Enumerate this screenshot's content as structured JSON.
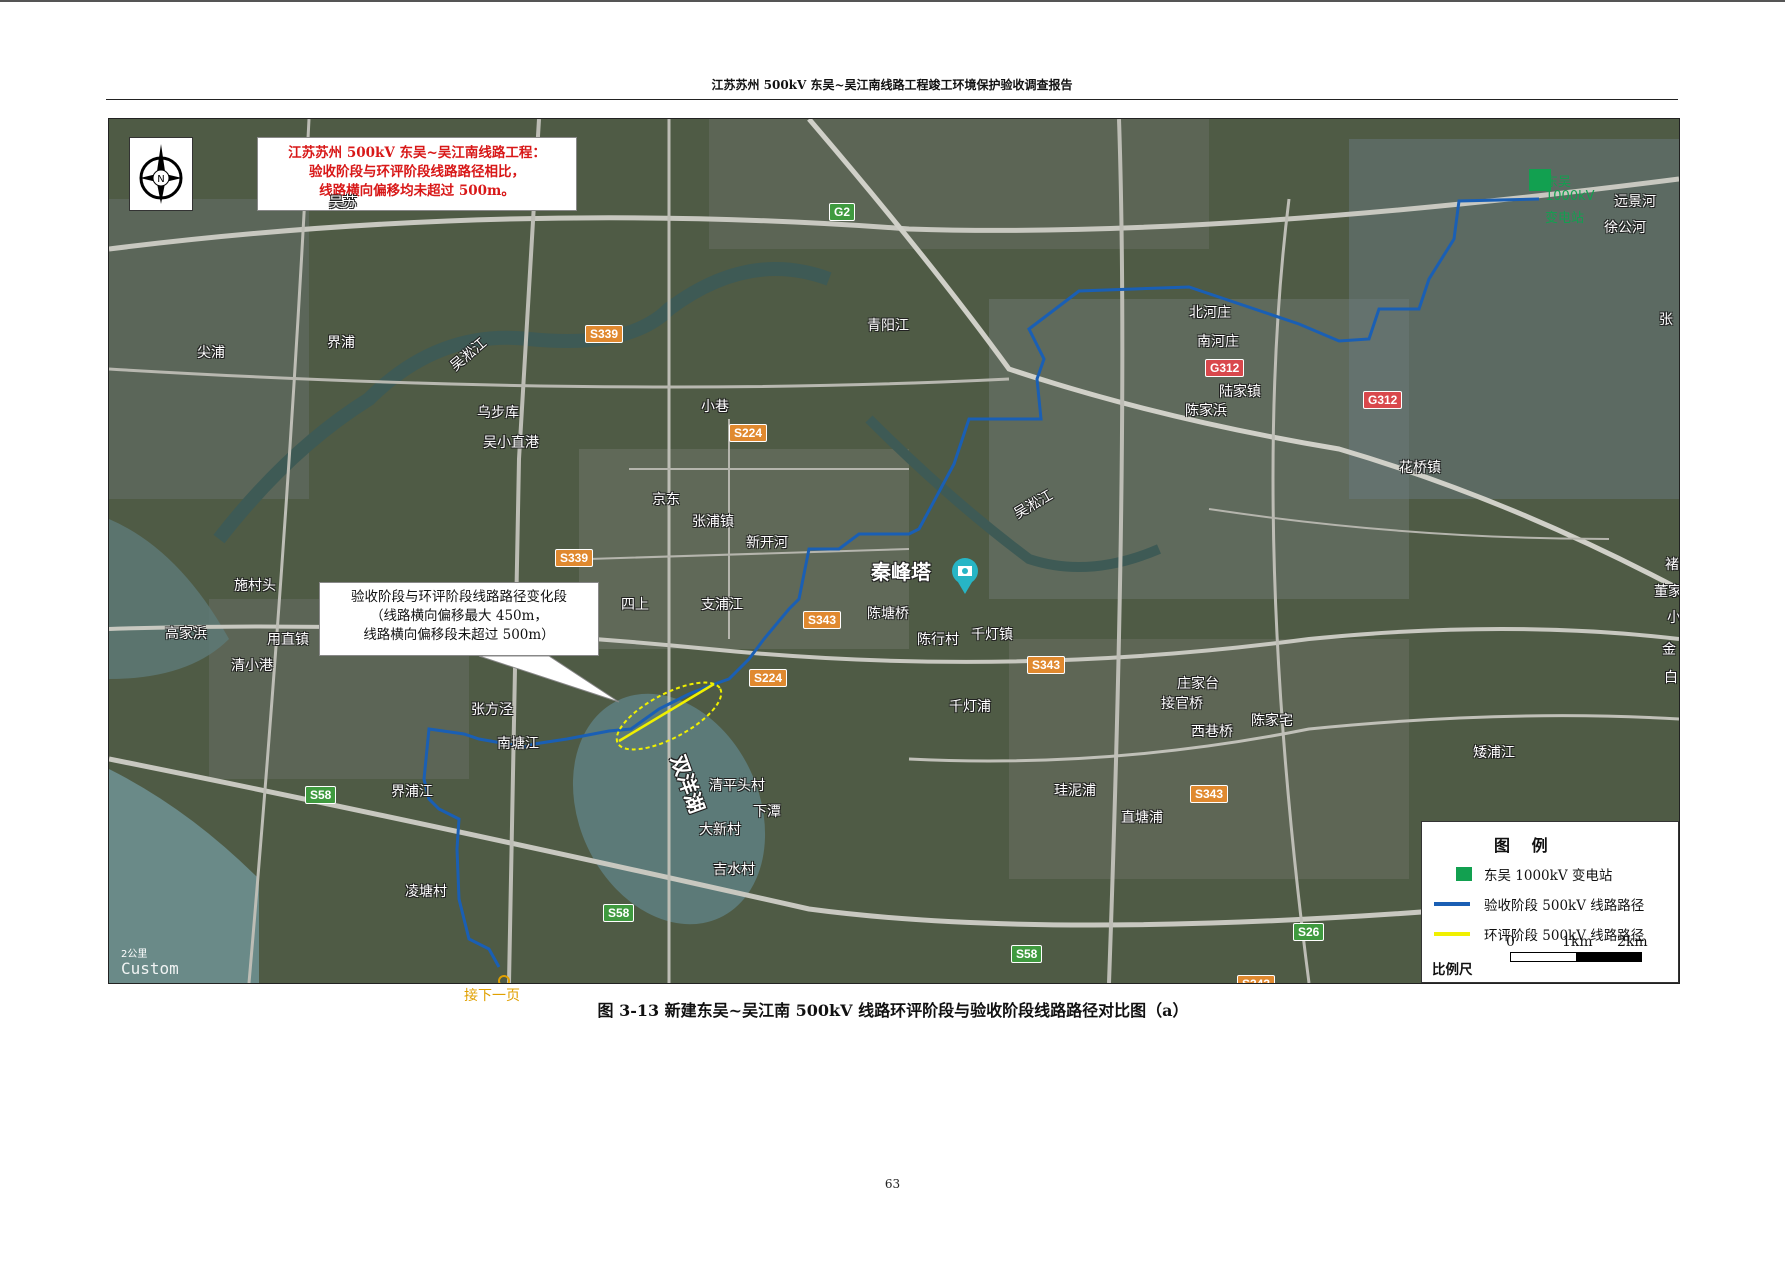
{
  "header": {
    "title": "江苏苏州 500kV 东吴~吴江南线路工程竣工环境保护验收调查报告"
  },
  "map": {
    "title_box": [
      "江苏苏州 500kV 东吴~吴江南线路工程：",
      "验收阶段与环评阶段线路路径相比，",
      "线路横向偏移均未超过 500m。"
    ],
    "callout": [
      "验收阶段与环评阶段线路路径变化段",
      "（线路横向偏移最大 450m，",
      "线路横向偏移段未超过 500m）"
    ],
    "north_label": "N",
    "places": {
      "p1": "远景河",
      "p2": "徐公河",
      "p3": "张",
      "p4": "北河庄",
      "p5": "南河庄",
      "p6": "陆家镇",
      "p7": "陈家浜",
      "p8": "花桥镇",
      "p9": "青阳江",
      "p10": "吴淞江",
      "p11": "界浦",
      "p12": "尖浦",
      "p13": "乌步库",
      "p14": "吴小直港",
      "p15": "小巷",
      "p16": "京东",
      "p17": "张浦镇",
      "p18": "新开河",
      "p19": "秦峰塔",
      "p20": "吴淞江",
      "p21": "施村头",
      "p22": "高家浜",
      "p23": "用直镇",
      "p24": "清小港",
      "p25": "四上",
      "p26": "支浦江",
      "p27": "陈塘桥",
      "p28": "陈行村",
      "p29": "千灯镇",
      "p30": "庄家台",
      "p31": "接官桥",
      "p32": "陈家宅",
      "p33": "西巷桥",
      "p34": "千灯浦",
      "p35": "张方泾",
      "p36": "南塘江",
      "p37": "双洋湖",
      "p38": "界浦江",
      "p39": "清平头村",
      "p40": "下潭",
      "p41": "大新村",
      "p42": "吉水村",
      "p43": "凌塘村",
      "p44": "矮浦江",
      "p45": "珪泥浦",
      "p46": "直塘浦",
      "p47": "褚",
      "p48": "董家",
      "p49": "金",
      "p50": "白",
      "p51": "小",
      "p52": "吴苏",
      "p53": "东吴",
      "p54": "1000kV",
      "p55": "变电站"
    },
    "roads": {
      "r1": "G2",
      "r2": "S339",
      "r3": "S339",
      "r4": "S224",
      "r5": "G312",
      "r6": "G312",
      "r7": "S343",
      "r8": "S343",
      "r9": "S224",
      "r10": "S343",
      "r11": "S58",
      "r12": "S58",
      "r13": "S58",
      "r14": "S26",
      "r15": "S343"
    },
    "mini_scale": "2公里",
    "watermark": "Custom",
    "next_page": "接下一页"
  },
  "legend": {
    "title": "图 例",
    "items": [
      "东吴 1000kV 变电站",
      "验收阶段 500kV 线路路径",
      "环评阶段 500kV 线路路径"
    ],
    "scale_label": "比例尺",
    "scale_ticks": [
      "0",
      "1km",
      "2km"
    ]
  },
  "colors": {
    "accept_route": "#1a5fb4",
    "eia_route": "#f0f000",
    "substation": "#12a050",
    "title_red": "#d81818"
  },
  "caption": "图 3-13 新建东吴~吴江南 500kV 线路环评阶段与验收阶段线路路径对比图（a）",
  "page_number": "63"
}
